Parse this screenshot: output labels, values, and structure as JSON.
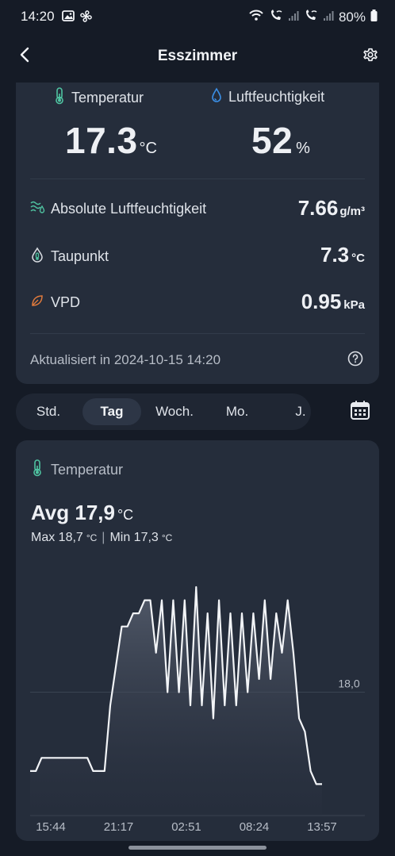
{
  "status_bar": {
    "time": "14:20",
    "battery": "80%",
    "icons": [
      "image-icon",
      "fan-icon",
      "wifi-icon",
      "wifi-call-icon",
      "signal-icon",
      "wifi-call-icon-2",
      "signal-icon-2",
      "battery-icon"
    ]
  },
  "header": {
    "title": "Esszimmer",
    "back_icon": "back-arrow-icon",
    "settings_icon": "gear-icon"
  },
  "primary": {
    "temperature": {
      "label": "Temperatur",
      "value": "17.3",
      "unit": "°C",
      "icon": "thermometer-icon"
    },
    "humidity": {
      "label": "Luftfeuchtigkeit",
      "value": "52",
      "unit": "%",
      "icon": "droplet-icon"
    }
  },
  "details": [
    {
      "label": "Absolute Luftfeuchtigkeit",
      "value": "7.66",
      "unit": "g/m³",
      "icon": "humidity-waves-icon"
    },
    {
      "label": "Taupunkt",
      "value": "7.3",
      "unit": "°C",
      "icon": "dewpoint-icon"
    },
    {
      "label": "VPD",
      "value": "0.95",
      "unit": "kPa",
      "icon": "leaf-icon"
    }
  ],
  "updated": {
    "text": "Aktualisiert in 2024-10-15 14:20",
    "icon": "help-circle-icon"
  },
  "range_tabs": {
    "items": [
      "Std.",
      "Tag",
      "Woch.",
      "Mo.",
      "J."
    ],
    "selected": "Tag",
    "calendar_icon": "calendar-icon"
  },
  "chart_card": {
    "title": "Temperatur",
    "avg_label": "Avg 17,9",
    "avg_unit": "°C",
    "max_label": "Max 18,7",
    "max_unit": "°C",
    "separator": "|",
    "min_label": "Min 17,3",
    "min_unit": "°C"
  },
  "colors": {
    "background": "#151b26",
    "card": "#252d3b",
    "accent_green": "#4fc3a1",
    "accent_blue": "#3b8fe6",
    "accent_orange": "#e07a3c",
    "line": "#f2f4f7"
  },
  "chart_data": {
    "type": "area",
    "title": "",
    "xlabel": "",
    "ylabel": "",
    "x_tick_labels": [
      "15:44",
      "21:17",
      "02:51",
      "08:24",
      "13:57"
    ],
    "y_reference_label": "18,0",
    "y_reference_value": 18.0,
    "ylim": [
      17.2,
      18.8
    ],
    "grid": "horizontal reference line",
    "series": [
      {
        "values": [
          17.4,
          17.4,
          17.5,
          17.5,
          17.5,
          17.5,
          17.5,
          17.5,
          17.5,
          17.5,
          17.5,
          17.4,
          17.4,
          17.4,
          17.9,
          18.2,
          18.5,
          18.5,
          18.6,
          18.6,
          18.7,
          18.7,
          18.3,
          18.7,
          18.0,
          18.7,
          18.0,
          18.7,
          17.9,
          18.8,
          17.9,
          18.6,
          17.8,
          18.7,
          17.9,
          18.6,
          17.9,
          18.6,
          18.0,
          18.6,
          18.1,
          18.7,
          18.1,
          18.6,
          18.3,
          18.7,
          18.3,
          17.8,
          17.7,
          17.4,
          17.3,
          17.3
        ]
      }
    ]
  }
}
